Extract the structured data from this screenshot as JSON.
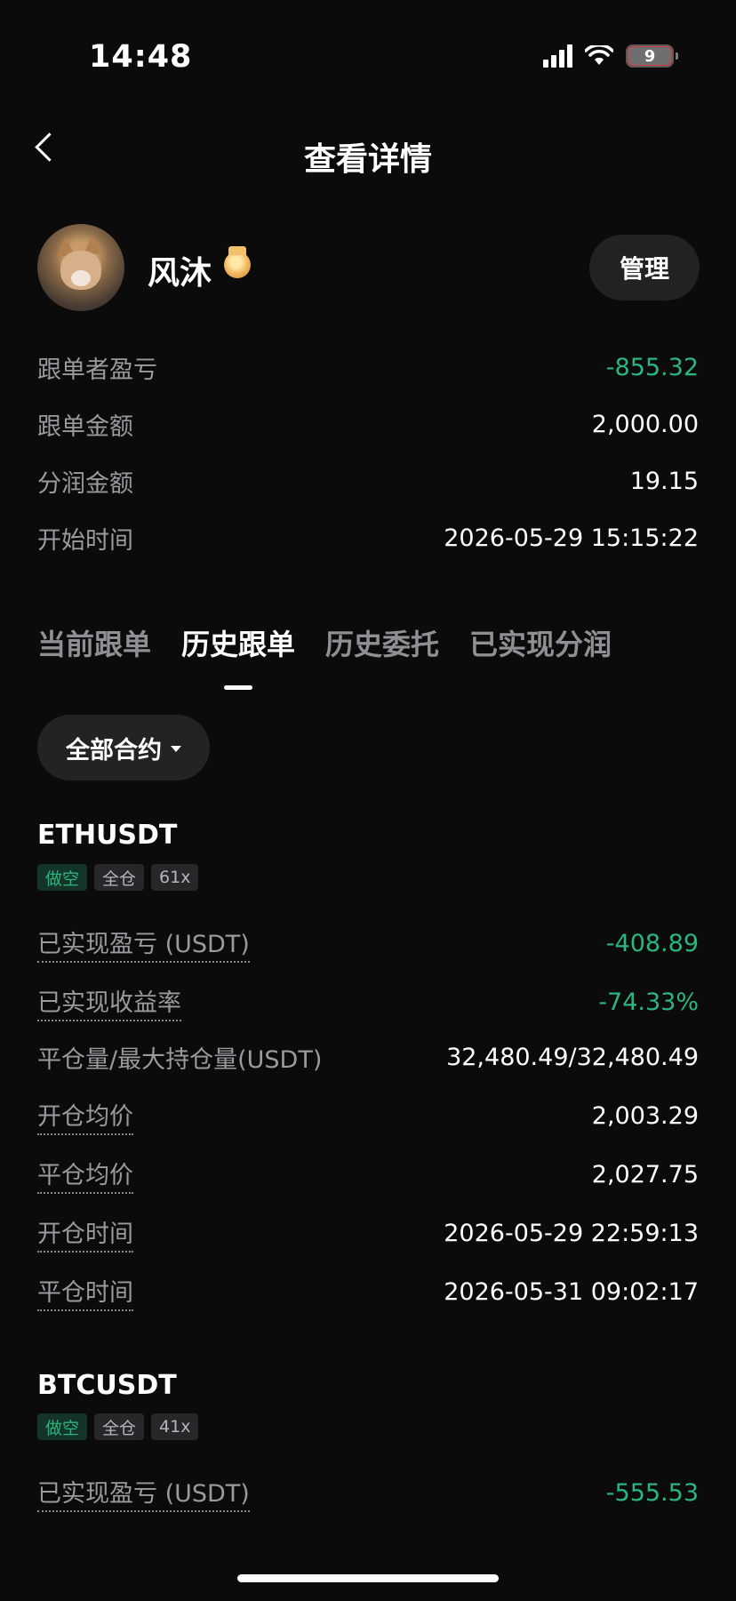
{
  "status_bar": {
    "time": "14:48",
    "battery": "9"
  },
  "header": {
    "title": "查看详情"
  },
  "profile": {
    "name": "风沐",
    "manage_label": "管理"
  },
  "summary": [
    {
      "label": "跟单者盈亏",
      "value": "-855.32"
    },
    {
      "label": "跟单金额",
      "value": "2,000.00"
    },
    {
      "label": "分润金额",
      "value": "19.15"
    },
    {
      "label": "开始时间",
      "value": "2026-05-29 15:15:22"
    }
  ],
  "tabs": [
    {
      "label": "当前跟单"
    },
    {
      "label": "历史跟单"
    },
    {
      "label": "历史委托"
    },
    {
      "label": "已实现分润"
    }
  ],
  "filter": {
    "label": "全部合约"
  },
  "positions": [
    {
      "symbol": "ETHUSDT",
      "badges": [
        "做空",
        "全仓",
        "61x"
      ],
      "rows": [
        {
          "label": "已实现盈亏 (USDT)",
          "value": "-408.89"
        },
        {
          "label": "已实现收益率",
          "value": "-74.33%"
        },
        {
          "label": "平仓量/最大持仓量(USDT)",
          "value": "32,480.49/32,480.49"
        },
        {
          "label": "开仓均价",
          "value": "2,003.29"
        },
        {
          "label": "平仓均价",
          "value": "2,027.75"
        },
        {
          "label": "开仓时间",
          "value": "2026-05-29 22:59:13"
        },
        {
          "label": "平仓时间",
          "value": "2026-05-31 09:02:17"
        }
      ]
    },
    {
      "symbol": "BTCUSDT",
      "badges": [
        "做空",
        "全仓",
        "41x"
      ],
      "rows": [
        {
          "label": "已实现盈亏 (USDT)",
          "value": "-555.53"
        }
      ]
    }
  ],
  "colors": {
    "loss": "#2bb67f",
    "background": "#0b0b0c"
  }
}
